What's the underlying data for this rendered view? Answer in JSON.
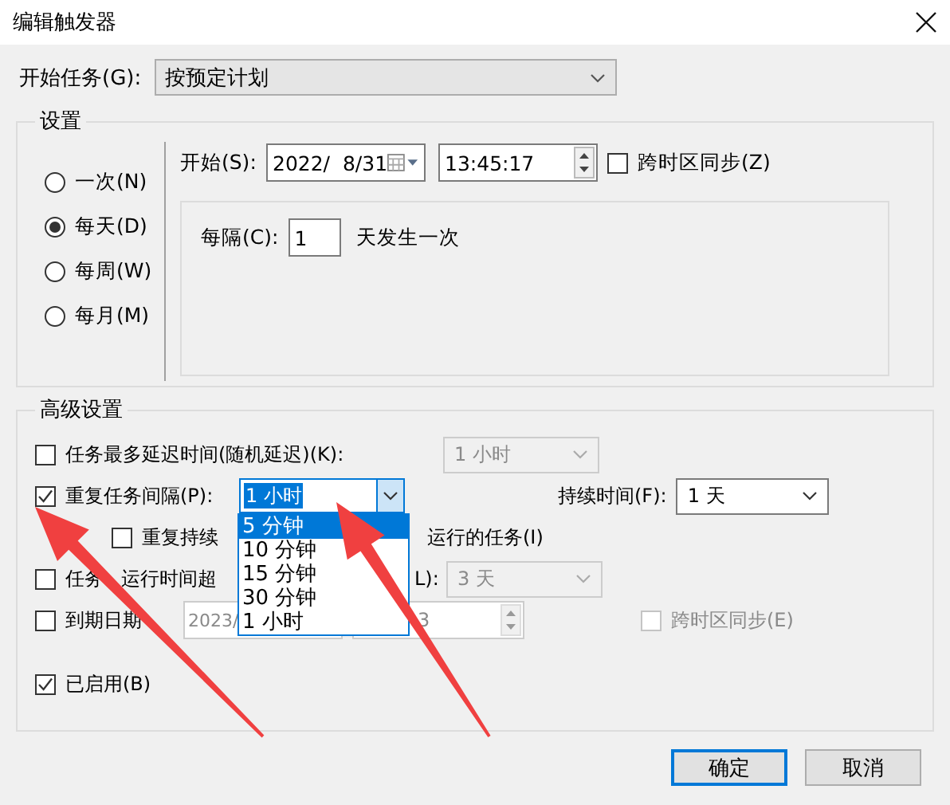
{
  "window": {
    "title": "编辑触发器"
  },
  "start_task": {
    "label": "开始任务(G):",
    "value": "按预定计划"
  },
  "settings": {
    "title": "设置",
    "schedule_options": [
      {
        "label": "一次(N)",
        "selected": false
      },
      {
        "label": "每天(D)",
        "selected": true
      },
      {
        "label": "每周(W)",
        "selected": false
      },
      {
        "label": "每月(M)",
        "selected": false
      }
    ],
    "start_label": "开始(S):",
    "start_date": "2022/  8/31",
    "start_time": "13:45:17",
    "sync_timezone": {
      "label": "跨时区同步(Z)",
      "checked": false
    },
    "recur_label": "每隔(C):",
    "recur_value": "1",
    "recur_suffix": "天发生一次"
  },
  "advanced": {
    "title": "高级设置",
    "delay": {
      "label": "任务最多延迟时间(随机延迟)(K):",
      "checked": false,
      "value": "1 小时",
      "disabled": true
    },
    "repeat": {
      "label": "重复任务间隔(P):",
      "checked": true,
      "value": "1 小时",
      "duration_label": "持续时间(F):",
      "duration_value": "1 天"
    },
    "repeat_options": [
      {
        "label": "5 分钟",
        "selected": true
      },
      {
        "label": "10 分钟",
        "selected": false
      },
      {
        "label": "15 分钟",
        "selected": false
      },
      {
        "label": "30 分钟",
        "selected": false
      },
      {
        "label": "1 小时",
        "selected": false
      }
    ],
    "stop_at_end": {
      "label": "重复持续",
      "label_tail": "运行的任务(I)",
      "checked": false
    },
    "stop_if_longer": {
      "label": "任务",
      "label_mid": "运行时间超",
      "label_tail": "L):",
      "checked": false,
      "value": "3 天",
      "disabled": true
    },
    "expire": {
      "label": "到期日期",
      "checked": false,
      "date": "2023/",
      "time": "3",
      "sync": {
        "label": "跨时区同步(E)",
        "checked": false,
        "disabled": true
      }
    },
    "enabled": {
      "label": "已启用(B)",
      "checked": true
    }
  },
  "buttons": [
    {
      "label": "确定",
      "default": true
    },
    {
      "label": "取消",
      "default": false
    }
  ]
}
